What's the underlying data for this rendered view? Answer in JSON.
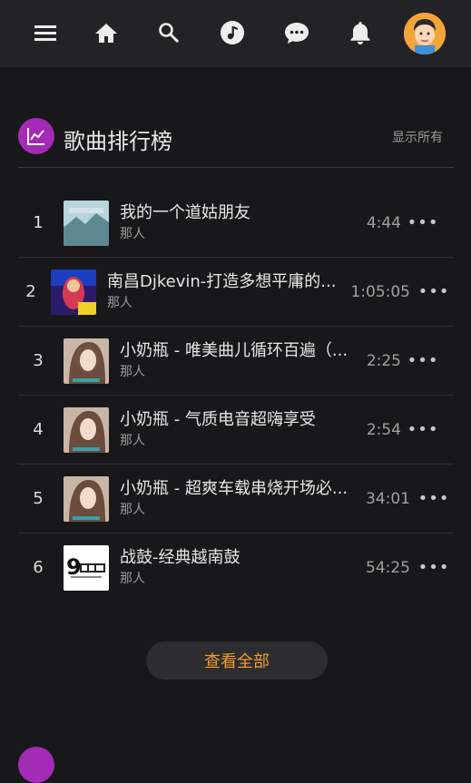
{
  "colors": {
    "accent": "#f29a2e",
    "section_icon": "#a32bb5",
    "background": "#18181a",
    "topbar": "#232325"
  },
  "topbar": {
    "icons": [
      "menu-icon",
      "home-icon",
      "search-icon",
      "music-icon",
      "chat-icon",
      "bell-icon"
    ]
  },
  "section": {
    "title": "歌曲排行榜",
    "show_all": "显示所有",
    "icon": "chart-line-icon"
  },
  "songs": [
    {
      "rank": "1",
      "title": "我的一个道姑朋友",
      "artist": "那人",
      "duration": "4:44"
    },
    {
      "rank": "2",
      "title": "南昌Djkevin-打造多想平庸的...",
      "artist": "那人",
      "duration": "1:05:05"
    },
    {
      "rank": "3",
      "title": "小奶瓶 - 唯美曲儿循环百遍（...",
      "artist": "那人",
      "duration": "2:25"
    },
    {
      "rank": "4",
      "title": "小奶瓶 - 气质电音超嗨享受",
      "artist": "那人",
      "duration": "2:54"
    },
    {
      "rank": "5",
      "title": "小奶瓶 - 超爽车载串烧开场必...",
      "artist": "那人",
      "duration": "34:01"
    },
    {
      "rank": "6",
      "title": "战鼓-经典越南鼓",
      "artist": "那人",
      "duration": "54:25"
    }
  ],
  "view_all": "查看全部"
}
